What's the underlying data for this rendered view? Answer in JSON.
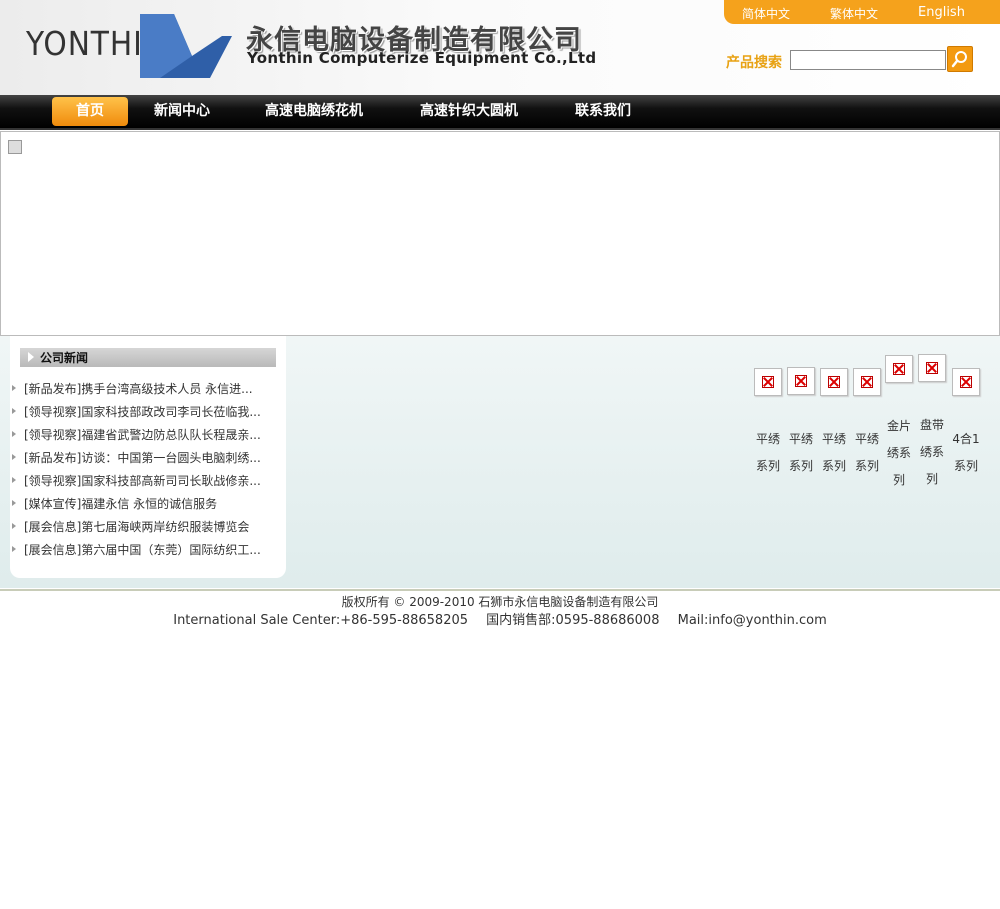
{
  "header": {
    "logo_text": "YONTHIN",
    "company_cn": "永信电脑设备制造有限公司",
    "company_en": "Yonthin Computerize Equipment Co.,Ltd",
    "languages": [
      "简体中文",
      "繁体中文",
      "English"
    ],
    "search_label": "产品搜索",
    "search_value": "",
    "search_icon": "magnifier-icon"
  },
  "nav": {
    "items": [
      "首页",
      "新闻中心",
      "高速电脑绣花机",
      "高速针织大圆机",
      "联系我们"
    ],
    "active": "首页"
  },
  "banner": {
    "icon": "broken-image-icon"
  },
  "news": {
    "title": "公司新闻",
    "items": [
      "[新品发布]携手台湾高级技术人员 永信进...",
      "[领导视察]国家科技部政改司李司长莅临我...",
      "[领导视察]福建省武警边防总队队长程晟亲...",
      "[新品发布]访谈：中国第一台圆头电脑刺绣...",
      "[领导视察]国家科技部高新司司长耿战修亲...",
      "[媒体宣传]福建永信  永恒的诚信服务",
      "[展会信息]第七届海峡两岸纺织服装博览会",
      "[展会信息]第六届中国（东莞）国际纺织工..."
    ]
  },
  "products": [
    "平绣系列",
    "平绣系列",
    "平绣系列",
    "平绣系列",
    "金片绣系列",
    "盘带绣系列",
    "4合1系列"
  ],
  "footer": {
    "copyright": "版权所有 © 2009-2010 石狮市永信电脑设备制造有限公司",
    "intl": "International Sale Center:+86-595-88658205",
    "domestic": "国内销售部:0595-88686008",
    "mail": "Mail:info@yonthin.com"
  },
  "colors": {
    "accent": "#f5a21c",
    "nav_bg": "#000000"
  }
}
